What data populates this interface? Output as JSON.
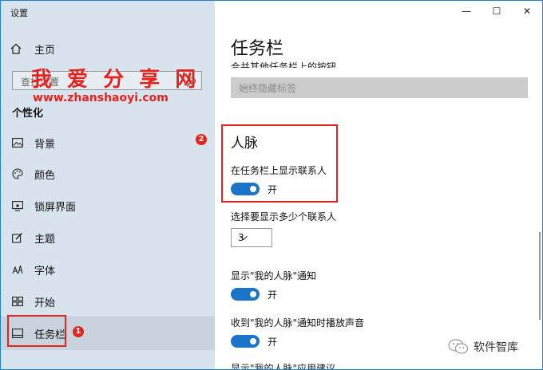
{
  "app": {
    "title": "设置"
  },
  "sidebar": {
    "home_label": "主页",
    "search_placeholder": "查找设置",
    "section_label": "个性化",
    "items": [
      {
        "label": "背景",
        "icon": "image-icon"
      },
      {
        "label": "颜色",
        "icon": "palette-icon"
      },
      {
        "label": "锁屏界面",
        "icon": "lock-screen-icon"
      },
      {
        "label": "主题",
        "icon": "theme-icon"
      },
      {
        "label": "字体",
        "icon": "font-icon"
      },
      {
        "label": "开始",
        "icon": "start-icon"
      },
      {
        "label": "任务栏",
        "icon": "taskbar-icon",
        "selected": true
      }
    ]
  },
  "watermark": {
    "title": "我 爱 分 享 网",
    "url": "www.zhanshaoyi.com"
  },
  "badges": {
    "first": "1",
    "second": "2"
  },
  "titlebar": {
    "minimize": "—",
    "maximize": "☐",
    "close": "✕"
  },
  "content": {
    "page_title": "任务栏",
    "cut_heading": "合并其他任务栏上的按钮",
    "combine_dropdown_value": "始终隐藏标签",
    "people_heading": "人脉",
    "show_contacts_label": "在任务栏上显示联系人",
    "show_contacts_state": "开",
    "contacts_count_label": "选择要显示多少个联系人",
    "contacts_count_value": "3",
    "notify_label": "显示\"我的人脉\"通知",
    "notify_state": "开",
    "sound_label": "收到\"我的人脉\"通知时播放声音",
    "sound_state": "开",
    "cut_bottom": "显示\"我的人脉\"应用建议"
  },
  "footer_mark": {
    "text": "软件智库"
  },
  "colors": {
    "accent": "#1a74c8",
    "highlight_red": "#e5221c",
    "sidebar_bg": "#d9e3ed"
  }
}
